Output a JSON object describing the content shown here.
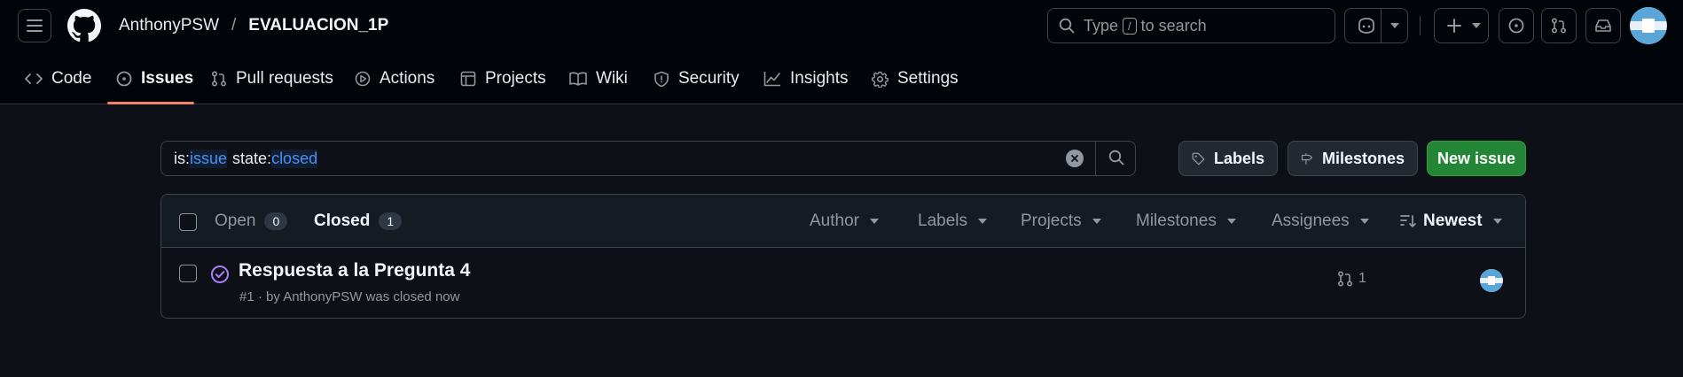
{
  "topbar": {
    "owner": "AnthonyPSW",
    "separator": "/",
    "repo": "EVALUACION_1P",
    "search": {
      "before": "Type",
      "key": "/",
      "after": "to search"
    }
  },
  "tabs": [
    {
      "label": "Code",
      "icon": "code-icon",
      "active": false
    },
    {
      "label": "Issues",
      "icon": "issue-opened-icon",
      "active": true
    },
    {
      "label": "Pull requests",
      "icon": "git-pull-request-icon",
      "active": false
    },
    {
      "label": "Actions",
      "icon": "play-icon",
      "active": false
    },
    {
      "label": "Projects",
      "icon": "table-icon",
      "active": false
    },
    {
      "label": "Wiki",
      "icon": "book-icon",
      "active": false
    },
    {
      "label": "Security",
      "icon": "shield-icon",
      "active": false
    },
    {
      "label": "Insights",
      "icon": "graph-icon",
      "active": false
    },
    {
      "label": "Settings",
      "icon": "gear-icon",
      "active": false
    }
  ],
  "filter": {
    "k1": "is:",
    "v1": "issue",
    "k2": "state:",
    "v2": "closed"
  },
  "actions": {
    "labels": "Labels",
    "milestones": "Milestones",
    "new_issue": "New issue"
  },
  "list": {
    "open_label": "Open",
    "open_count": "0",
    "closed_label": "Closed",
    "closed_count": "1",
    "filters": {
      "author": "Author",
      "labels": "Labels",
      "projects": "Projects",
      "milestones": "Milestones",
      "assignees": "Assignees",
      "sort": "Newest"
    }
  },
  "issues": [
    {
      "title": "Respuesta a la Pregunta 4",
      "meta": "#1 · by AnthonyPSW was closed now",
      "linked_prs": "1",
      "state": "closed"
    }
  ],
  "colors": {
    "accent_tab": "#f78166",
    "primary_button": "#238636",
    "closed_state": "#ab7df8",
    "link_value": "#4493f8"
  }
}
